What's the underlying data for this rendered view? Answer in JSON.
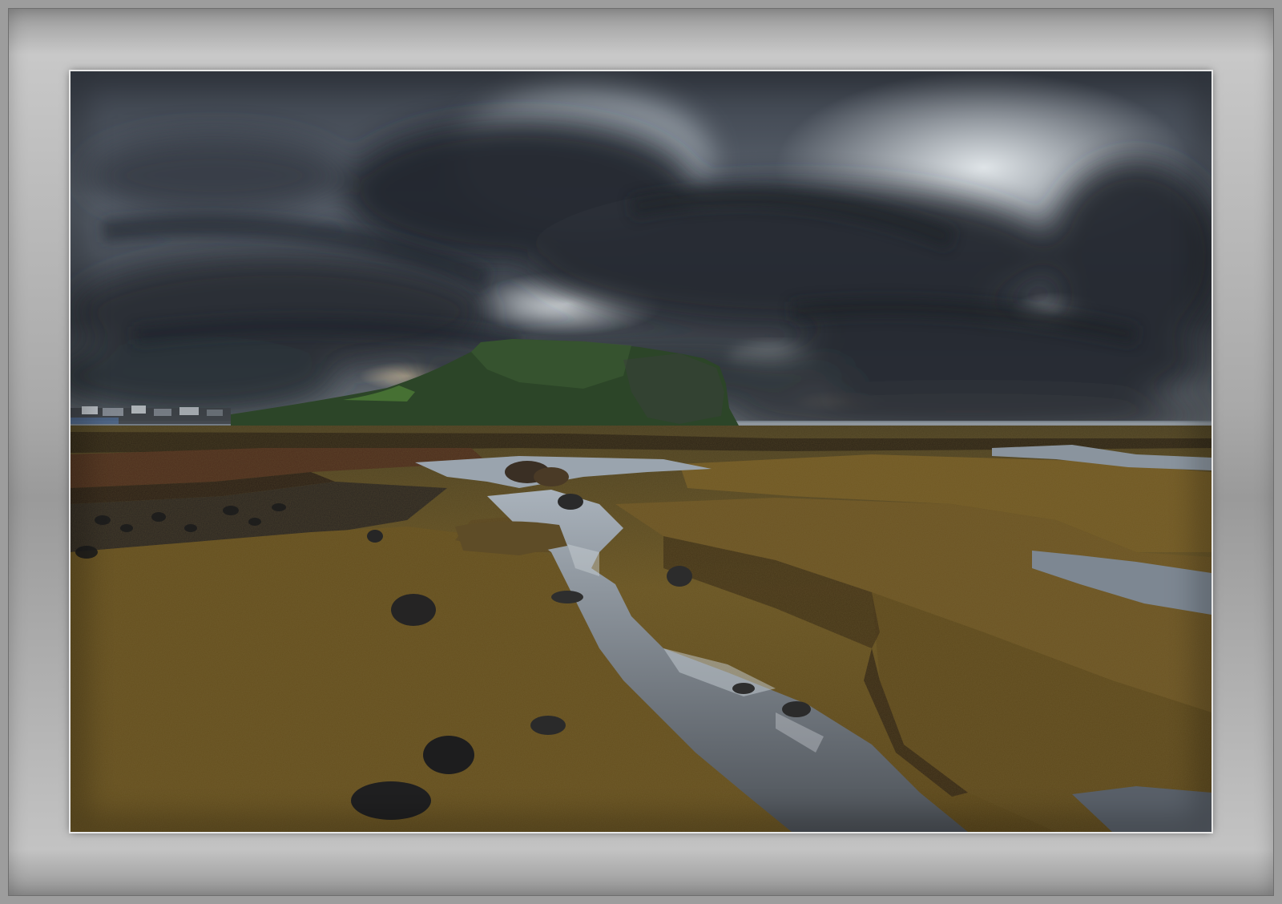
{
  "image": {
    "subject": "coastal-rock-tidepools-landscape",
    "frame_color": "#a8a8a8",
    "sky_colors": [
      "#2f343d",
      "#4a515c",
      "#9fa9b3",
      "#d9dfe3"
    ],
    "hill_color": "#2e4a2a",
    "rock_colors": [
      "#5b4a1f",
      "#7a6526",
      "#3a2c1c"
    ],
    "water_color": "#8c96a2"
  }
}
